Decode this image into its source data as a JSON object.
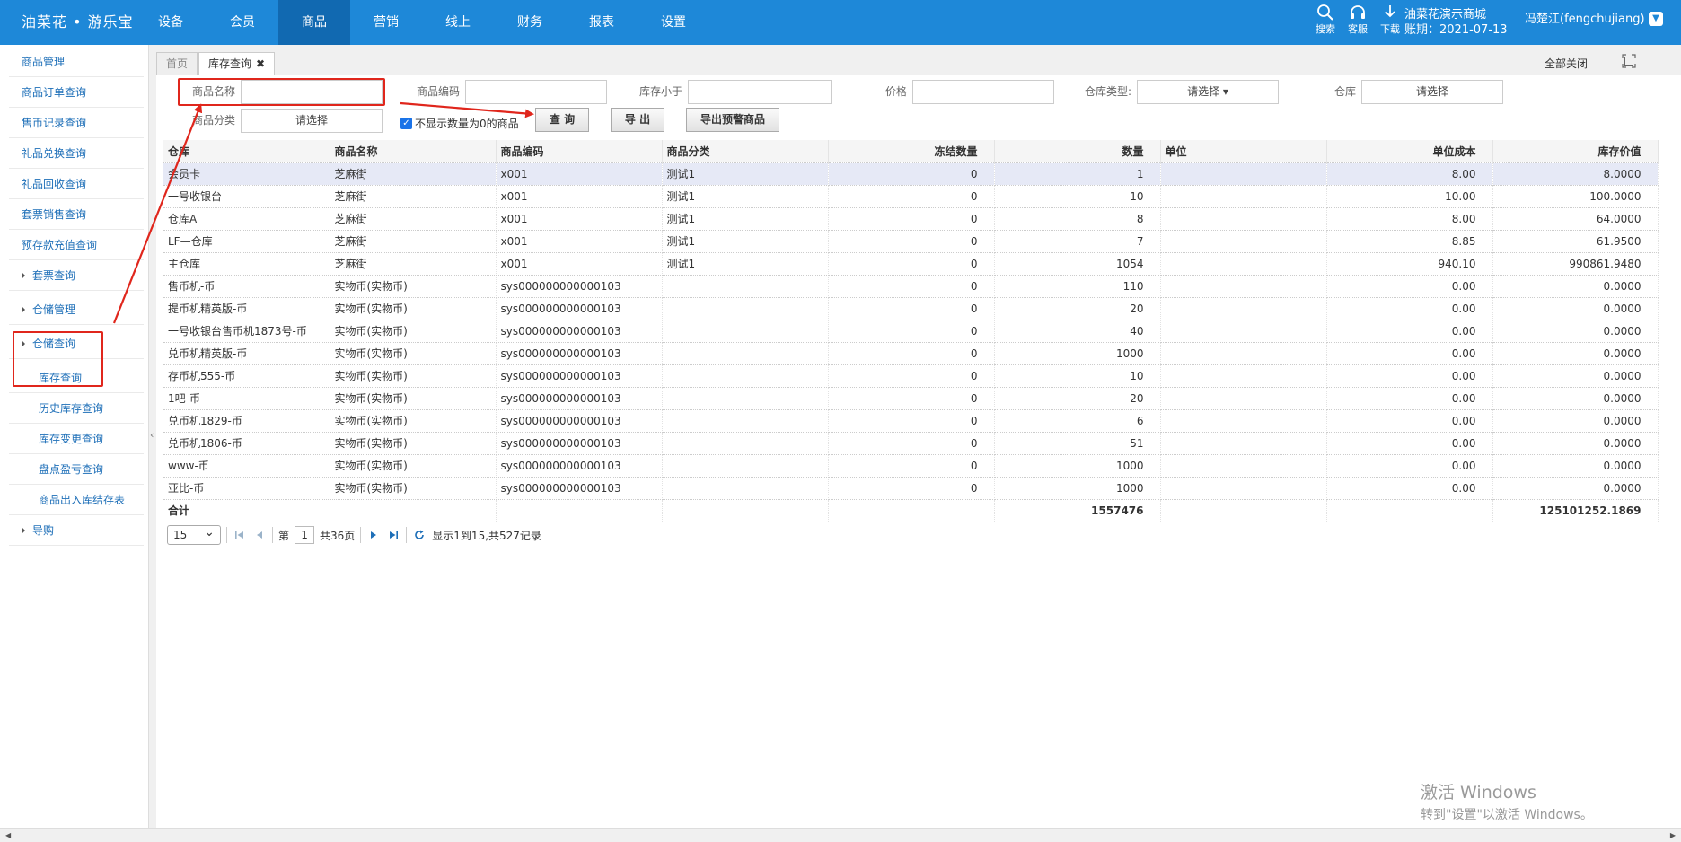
{
  "header": {
    "brand": "油菜花 • 游乐宝",
    "nav": [
      "设备",
      "会员",
      "商品",
      "营销",
      "线上",
      "财务",
      "报表",
      "设置"
    ],
    "active_nav": "商品",
    "tools": [
      {
        "label": "搜索",
        "icon": "search-icon"
      },
      {
        "label": "客服",
        "icon": "headset-icon"
      },
      {
        "label": "下载",
        "icon": "download-icon"
      }
    ],
    "store_name": "油菜花演示商城",
    "account_period": "账期：2021-07-13",
    "user": "冯楚江(fengchujiang)"
  },
  "sidebar": {
    "items": [
      {
        "label": "商品管理",
        "type": "item"
      },
      {
        "label": "商品订单查询",
        "type": "item"
      },
      {
        "label": "售币记录查询",
        "type": "item"
      },
      {
        "label": "礼品兑换查询",
        "type": "item"
      },
      {
        "label": "礼品回收查询",
        "type": "item"
      },
      {
        "label": "套票销售查询",
        "type": "item"
      },
      {
        "label": "预存款充值查询",
        "type": "item"
      },
      {
        "label": "套票查询",
        "type": "group"
      },
      {
        "label": "仓储管理",
        "type": "group"
      },
      {
        "label": "仓储查询",
        "type": "group"
      },
      {
        "label": "库存查询",
        "type": "sub"
      },
      {
        "label": "历史库存查询",
        "type": "sub"
      },
      {
        "label": "库存变更查询",
        "type": "sub"
      },
      {
        "label": "盘点盈亏查询",
        "type": "sub"
      },
      {
        "label": "商品出入库结存表",
        "type": "sub"
      },
      {
        "label": "导购",
        "type": "group"
      }
    ],
    "collapse_glyph": "‹"
  },
  "tabs": {
    "home": "首页",
    "active": "库存查询",
    "close_all": "全部关闭"
  },
  "filters": {
    "name_label": "商品名称",
    "name_value": "",
    "code_label": "商品编码",
    "code_value": "",
    "stock_label": "库存小于",
    "stock_value": "",
    "price_label": "价格",
    "price_value": "-",
    "wh_type_label": "仓库类型:",
    "wh_type_value": "请选择",
    "wh_label": "仓库",
    "wh_value": "请选择",
    "category_label": "商品分类",
    "category_value": "请选择",
    "hide_zero_label": "不显示数量为0的商品",
    "hide_zero_checked": true,
    "query_btn": "查 询",
    "export_btn": "导 出",
    "export_warn_btn": "导出预警商品"
  },
  "table": {
    "columns": [
      "仓库",
      "商品名称",
      "商品编码",
      "商品分类",
      "冻结数量",
      "数量",
      "单位",
      "单位成本",
      "库存价值"
    ],
    "rows": [
      [
        "会员卡",
        "芝麻街",
        "x001",
        "测试1",
        "0",
        "1",
        "",
        "8.00",
        "8.0000"
      ],
      [
        "一号收银台",
        "芝麻街",
        "x001",
        "测试1",
        "0",
        "10",
        "",
        "10.00",
        "100.0000"
      ],
      [
        "仓库A",
        "芝麻街",
        "x001",
        "测试1",
        "0",
        "8",
        "",
        "8.00",
        "64.0000"
      ],
      [
        "LF—仓库",
        "芝麻街",
        "x001",
        "测试1",
        "0",
        "7",
        "",
        "8.85",
        "61.9500"
      ],
      [
        "主仓库",
        "芝麻街",
        "x001",
        "测试1",
        "0",
        "1054",
        "",
        "940.10",
        "990861.9480"
      ],
      [
        "售币机-币",
        "实物币(实物币)",
        "sys000000000000103",
        "",
        "0",
        "110",
        "",
        "0.00",
        "0.0000"
      ],
      [
        "提币机精英版-币",
        "实物币(实物币)",
        "sys000000000000103",
        "",
        "0",
        "20",
        "",
        "0.00",
        "0.0000"
      ],
      [
        "一号收银台售币机1873号-币",
        "实物币(实物币)",
        "sys000000000000103",
        "",
        "0",
        "40",
        "",
        "0.00",
        "0.0000"
      ],
      [
        "兑币机精英版-币",
        "实物币(实物币)",
        "sys000000000000103",
        "",
        "0",
        "1000",
        "",
        "0.00",
        "0.0000"
      ],
      [
        "存币机555-币",
        "实物币(实物币)",
        "sys000000000000103",
        "",
        "0",
        "10",
        "",
        "0.00",
        "0.0000"
      ],
      [
        "1吧-币",
        "实物币(实物币)",
        "sys000000000000103",
        "",
        "0",
        "20",
        "",
        "0.00",
        "0.0000"
      ],
      [
        "兑币机1829-币",
        "实物币(实物币)",
        "sys000000000000103",
        "",
        "0",
        "6",
        "",
        "0.00",
        "0.0000"
      ],
      [
        "兑币机1806-币",
        "实物币(实物币)",
        "sys000000000000103",
        "",
        "0",
        "51",
        "",
        "0.00",
        "0.0000"
      ],
      [
        "www-币",
        "实物币(实物币)",
        "sys000000000000103",
        "",
        "0",
        "1000",
        "",
        "0.00",
        "0.0000"
      ],
      [
        "亚比-币",
        "实物币(实物币)",
        "sys000000000000103",
        "",
        "0",
        "1000",
        "",
        "0.00",
        "0.0000"
      ]
    ],
    "total_label": "合计",
    "total_qty": "1557476",
    "total_value": "125101252.1869"
  },
  "pager": {
    "page_size": "15",
    "page_prefix": "第",
    "page": "1",
    "page_total": "共36页",
    "summary": "显示1到15,共527记录"
  },
  "watermark": {
    "title": "激活 Windows",
    "subtitle": "转到\"设置\"以激活 Windows。"
  },
  "colors": {
    "header": "#1e88d8",
    "active_nav": "#1169b1",
    "annotation": "#e0261c",
    "link": "#1e6fb8"
  }
}
